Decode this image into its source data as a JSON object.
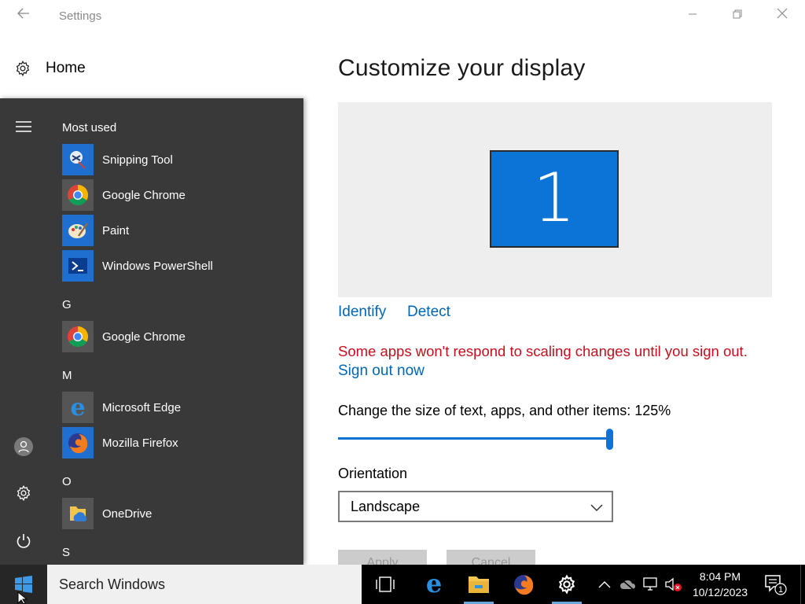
{
  "window": {
    "title": "Settings",
    "back_icon": "back-arrow-icon",
    "controls": [
      "minimize-icon",
      "restore-icon",
      "close-icon"
    ]
  },
  "nav": {
    "home_label": "Home"
  },
  "main": {
    "title": "Customize your display",
    "monitor_number": "1",
    "identify_label": "Identify",
    "detect_label": "Detect",
    "scaling_warning": "Some apps won't respond to scaling changes until you sign out.",
    "sign_out_label": "Sign out now",
    "scale_label": "Change the size of text, apps, and other items: 125%",
    "scale_slider_fraction": 1.0,
    "orientation_label": "Orientation",
    "orientation_value": "Landscape",
    "apply_label": "Apply",
    "cancel_label": "Cancel",
    "accent_color": "#0c74d6",
    "warning_color": "#c50f1f"
  },
  "start_menu": {
    "most_used_header": "Most used",
    "most_used": [
      {
        "label": "Snipping Tool",
        "icon": "snipping-tool-icon"
      },
      {
        "label": "Google Chrome",
        "icon": "chrome-icon"
      },
      {
        "label": "Paint",
        "icon": "paint-icon"
      },
      {
        "label": "Windows PowerShell",
        "icon": "powershell-icon"
      }
    ],
    "sections": [
      {
        "letter": "G",
        "apps": [
          {
            "label": "Google Chrome",
            "icon": "chrome-icon"
          }
        ]
      },
      {
        "letter": "M",
        "apps": [
          {
            "label": "Microsoft Edge",
            "icon": "edge-icon"
          },
          {
            "label": "Mozilla Firefox",
            "icon": "firefox-icon"
          }
        ]
      },
      {
        "letter": "O",
        "apps": [
          {
            "label": "OneDrive",
            "icon": "onedrive-icon"
          }
        ]
      },
      {
        "letter": "S",
        "apps": []
      }
    ],
    "rail_icons": [
      "hamburger-icon",
      "user-avatar-icon",
      "settings-gear-icon",
      "power-icon"
    ]
  },
  "taskbar": {
    "search_placeholder": "Search Windows",
    "pinned": [
      "task-view-icon",
      "edge-icon",
      "file-explorer-icon",
      "firefox-icon",
      "settings-gear-icon"
    ],
    "tray": [
      "chevron-up-icon",
      "onedrive-cloud-icon",
      "network-icon",
      "volume-muted-icon"
    ],
    "time": "8:04 PM",
    "date": "10/12/2023",
    "notification_count": "1"
  }
}
